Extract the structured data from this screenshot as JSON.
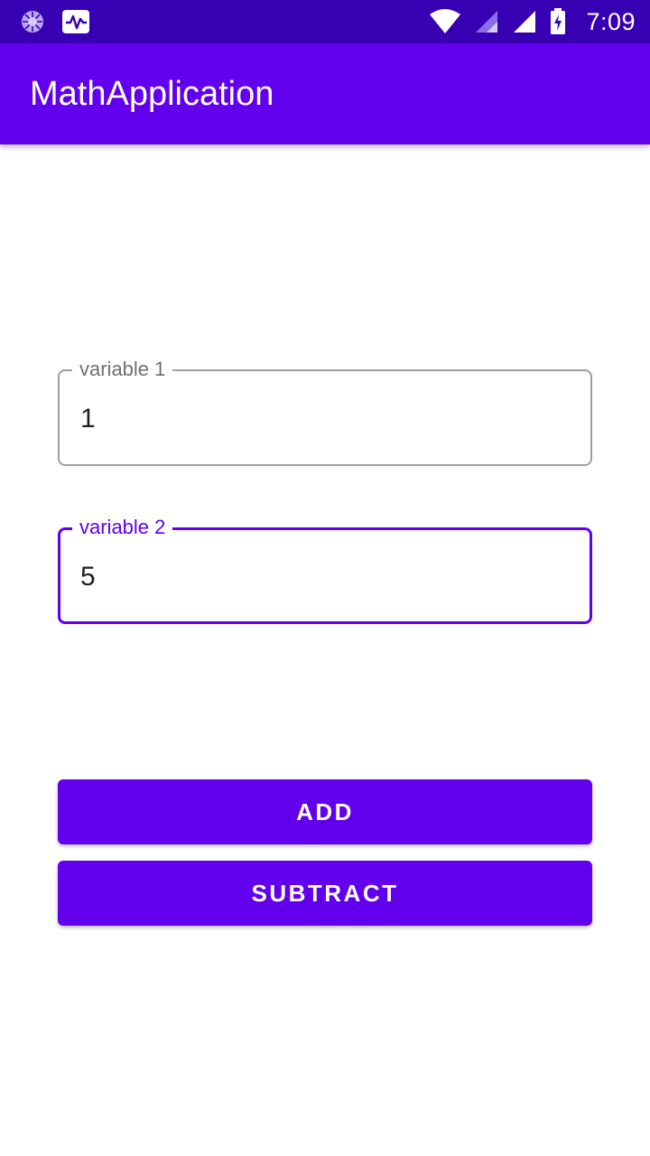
{
  "status_bar": {
    "time": "7:09",
    "icons": [
      "sync-spinner-icon",
      "activity-monitor-icon",
      "wifi-icon",
      "signal-weak-icon",
      "signal-icon",
      "battery-charging-icon"
    ],
    "background": "#3700B3"
  },
  "app_bar": {
    "title": "MathApplication",
    "background": "#6200EE"
  },
  "form": {
    "field1": {
      "label": "variable 1",
      "value": "1"
    },
    "field2": {
      "label": "variable 2",
      "value": "5",
      "focused": true
    }
  },
  "buttons": {
    "add_label": "ADD",
    "subtract_label": "SUBTRACT"
  },
  "colors": {
    "accent": "#6200EE",
    "accent_dark": "#3700B3",
    "outline": "#9e9e9e"
  }
}
